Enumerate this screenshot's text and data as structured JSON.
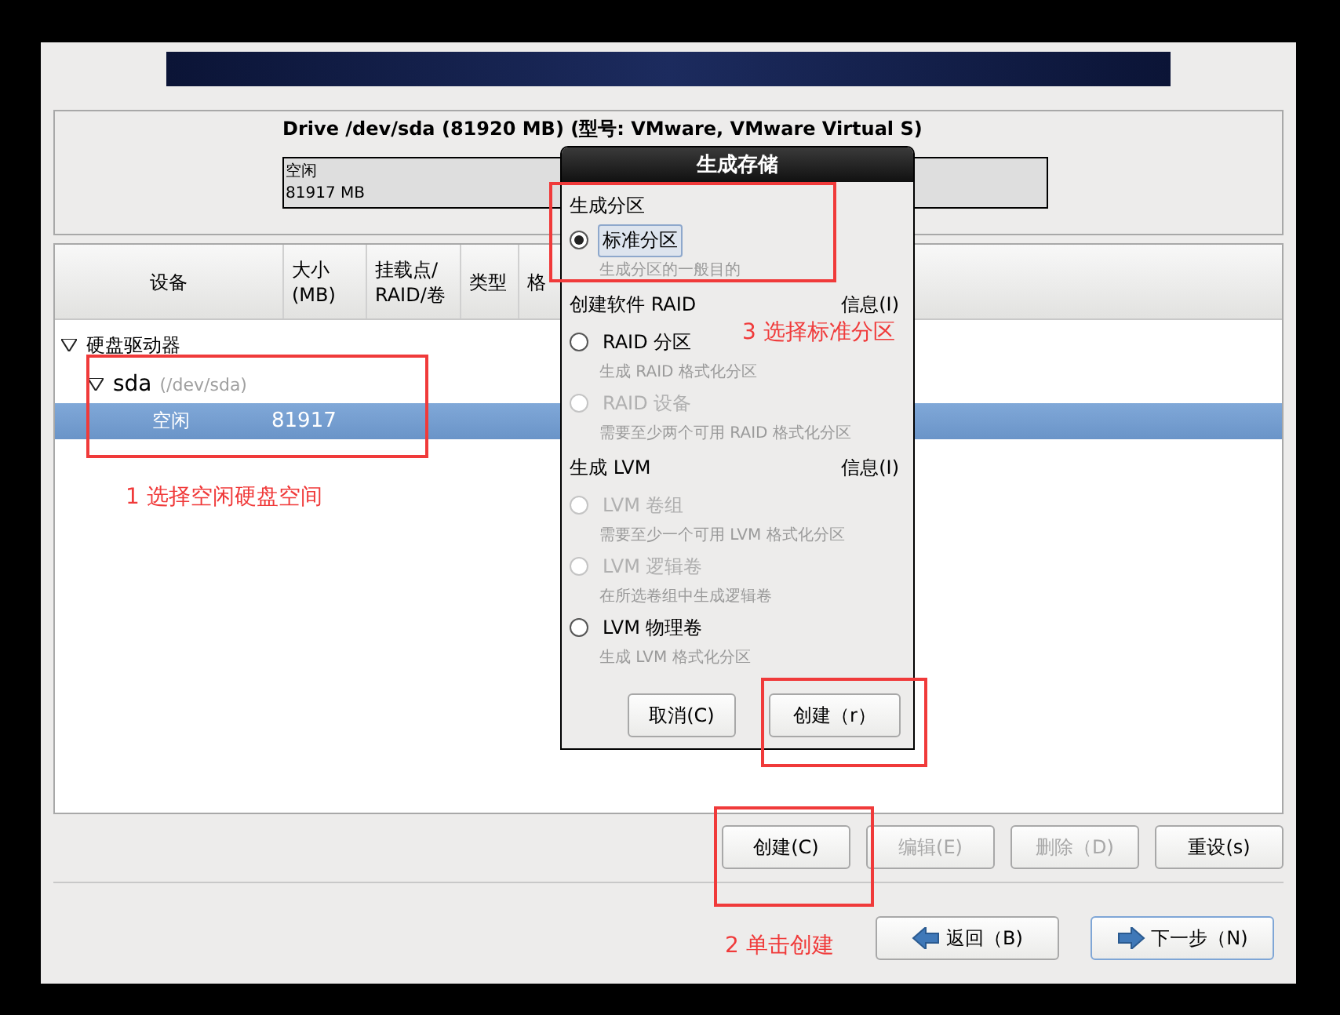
{
  "drive": {
    "title": "Drive /dev/sda (81920 MB) (型号: VMware, VMware Virtual S)",
    "segment": {
      "label": "空闲",
      "size": "81917 MB"
    }
  },
  "table": {
    "columns": [
      "设备",
      "大小\n(MB)",
      "挂载点/\nRAID/卷",
      "类型",
      "格"
    ],
    "rows": [
      {
        "device": "硬盘驱动器",
        "expanded": true,
        "selected": false,
        "children": [
          {
            "device": "sda",
            "path": "(/dev/sda)",
            "expanded": true,
            "selected": false,
            "children": [
              {
                "device": "空闲",
                "size": "81917",
                "selected": true
              }
            ]
          }
        ]
      }
    ]
  },
  "action_buttons": [
    {
      "label": "创建(C)",
      "disabled": false
    },
    {
      "label": "编辑(E)",
      "disabled": true
    },
    {
      "label": "删除（D)",
      "disabled": true
    },
    {
      "label": "重设(s)",
      "disabled": false
    }
  ],
  "nav_buttons": [
    {
      "label": "返回（B)",
      "kind": "back",
      "default": false
    },
    {
      "label": "下一步（N)",
      "kind": "next",
      "default": true
    }
  ],
  "dialog": {
    "title": "生成存储",
    "sections": [
      {
        "title": "生成分区",
        "options": [
          {
            "label": "标准分区",
            "description": "生成分区的一般目的",
            "selected": true,
            "disabled": false
          }
        ]
      },
      {
        "title": "创建软件 RAID",
        "info": "信息(I)",
        "options": [
          {
            "label": "RAID 分区",
            "description": "生成 RAID 格式化分区",
            "selected": false,
            "disabled": false
          },
          {
            "label": "RAID 设备",
            "description": "需要至少两个可用 RAID 格式化分区",
            "selected": false,
            "disabled": true
          }
        ]
      },
      {
        "title": "生成 LVM",
        "info": "信息(I)",
        "options": [
          {
            "label": "LVM 卷组",
            "description": "需要至少一个可用 LVM 格式化分区",
            "selected": false,
            "disabled": true
          },
          {
            "label": "LVM 逻辑卷",
            "description": "在所选卷组中生成逻辑卷",
            "selected": false,
            "disabled": true
          },
          {
            "label": "LVM 物理卷",
            "description": "生成 LVM 格式化分区",
            "selected": false,
            "disabled": false
          }
        ]
      }
    ],
    "buttons": [
      "取消(C)",
      "创建（r）"
    ]
  },
  "annotations": [
    "1  选择空闲硬盘空间",
    "3  选择标准分区",
    "2  单击创建"
  ]
}
